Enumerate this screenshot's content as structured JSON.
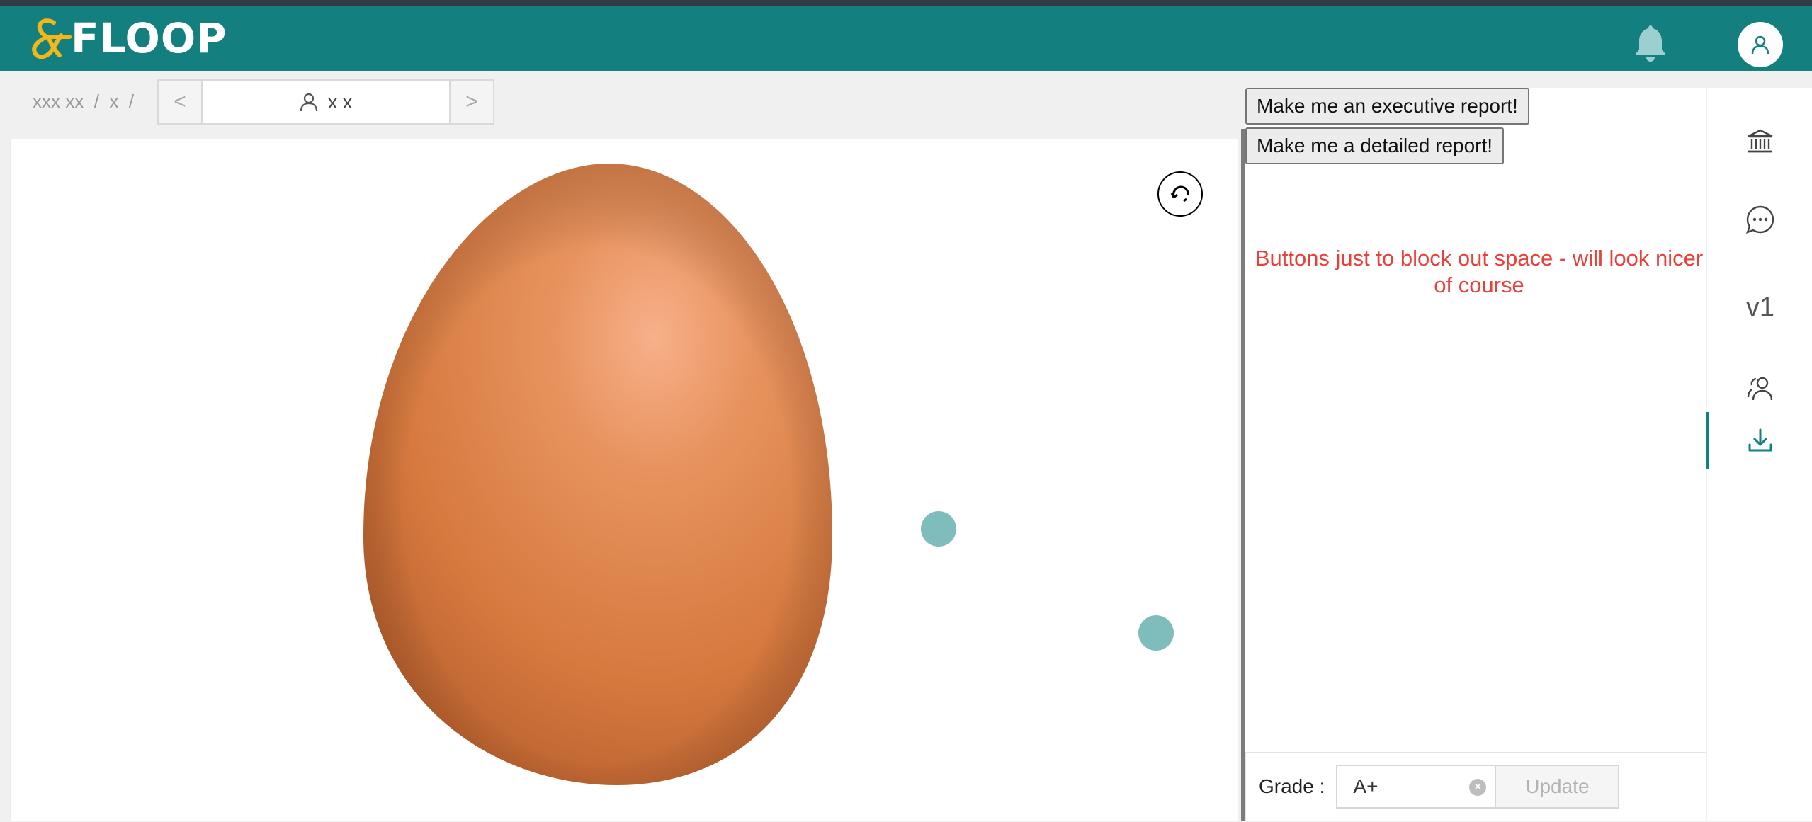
{
  "app": {
    "logo_text": "FLOOP",
    "brand_color": "#137f7f",
    "accent_color": "#f3b71a"
  },
  "header": {
    "notifications_icon": "bell-icon",
    "profile_icon": "user-icon"
  },
  "breadcrumb": [
    "xxx xx",
    "/",
    "x",
    "/"
  ],
  "student_nav": {
    "prev_label": "<",
    "next_label": ">",
    "student_icon": "user-icon",
    "student_name": "x x"
  },
  "image_viewer": {
    "rotate_icon": "rotate-icon",
    "image_subject": "brown egg",
    "marker_color": "#7fbcbc"
  },
  "reports": {
    "executive_button": "Make me an executive report!",
    "detailed_button": "Make me a detailed report!",
    "note": "Buttons just to block out space - will look nicer of course"
  },
  "grade": {
    "label": "Grade :",
    "value": "A+",
    "clear_icon": "clear-icon",
    "update_button": "Update"
  },
  "sidebar": {
    "items": [
      {
        "icon": "bank-icon"
      },
      {
        "icon": "chat-icon"
      },
      {
        "label": "v1"
      },
      {
        "icon": "users-icon"
      },
      {
        "icon": "download-icon",
        "active": true
      }
    ]
  }
}
